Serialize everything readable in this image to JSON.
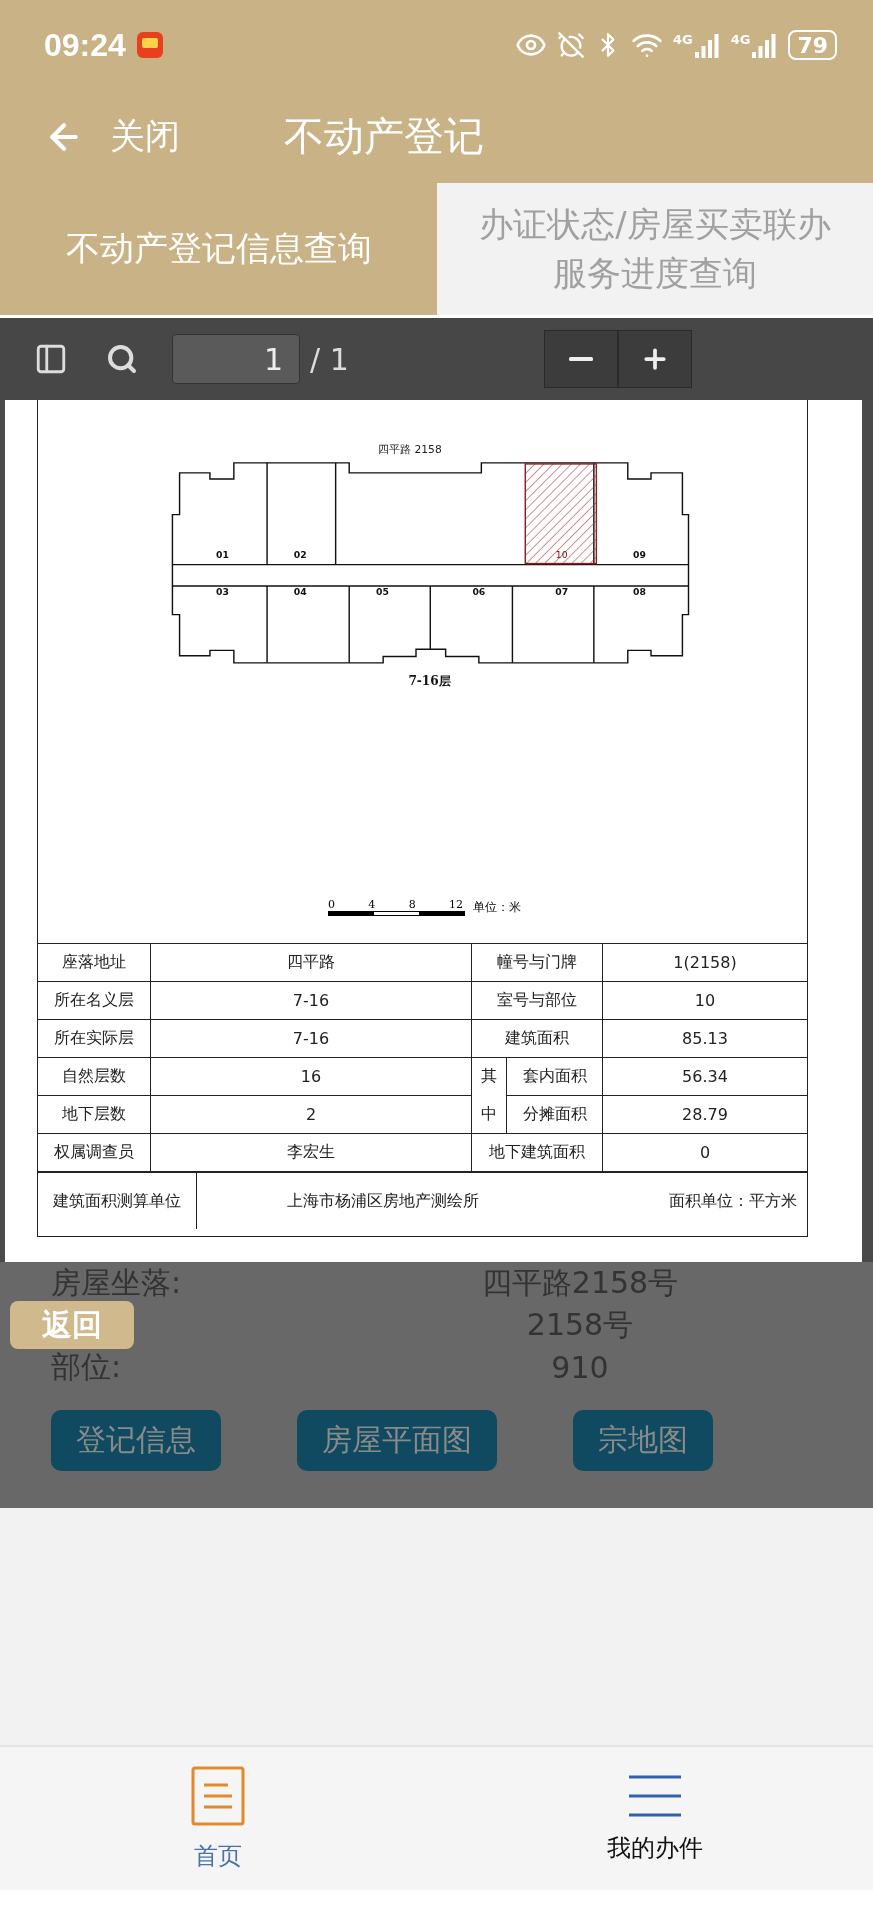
{
  "status_bar": {
    "time": "09:24",
    "networks": [
      "4G",
      "4G"
    ],
    "battery": "79"
  },
  "header": {
    "back_label": "关闭",
    "title": "不动产登记"
  },
  "tabs": [
    {
      "label": "不动产登记信息查询",
      "selected": true
    },
    {
      "label": "办证状态/房屋买卖联办服务进度查询",
      "selected": false
    }
  ],
  "pdf_viewer": {
    "page_value": "1",
    "page_total": "/ 1",
    "plan": {
      "title": "四平路 2158",
      "floor_label": "7-16层",
      "units": [
        {
          "label": "01",
          "selected": false
        },
        {
          "label": "02",
          "selected": false
        },
        {
          "label": "10",
          "selected": true
        },
        {
          "label": "09",
          "selected": false
        },
        {
          "label": "03",
          "selected": false
        },
        {
          "label": "04",
          "selected": false
        },
        {
          "label": "05",
          "selected": false
        },
        {
          "label": "06",
          "selected": false
        },
        {
          "label": "07",
          "selected": false
        },
        {
          "label": "08",
          "selected": false
        }
      ],
      "scale_ticks": [
        "0",
        "4",
        "8",
        "12"
      ],
      "scale_unit": "单位：米"
    },
    "table": {
      "rows": [
        {
          "label": "座落地址",
          "value": "四平路",
          "label_2": "幢号与门牌",
          "value_2": "1(2158)"
        },
        {
          "label": "所在名义层",
          "value": "7-16",
          "label_2": "室号与部位",
          "value_2": "10"
        },
        {
          "label": "所在实际层",
          "value": "7-16",
          "label_2": "建筑面积",
          "value_2": "85.13"
        },
        {
          "label": "自然层数",
          "value": "16",
          "group": "其",
          "label_2": "套内面积",
          "value_2": "56.34"
        },
        {
          "label": "地下层数",
          "value": "2",
          "group": "中",
          "label_2": "分摊面积",
          "value_2": "28.79"
        },
        {
          "label": "权属调查员",
          "value": "李宏生",
          "label_2": "地下建筑面积",
          "value_2": "0"
        }
      ],
      "footer": {
        "label": "建筑面积测算单位",
        "value": "上海市杨浦区房地产测绘所",
        "note": "面积单位：平方米"
      }
    }
  },
  "back_button": "返回",
  "info": {
    "rows": [
      {
        "label": "房屋坐落:",
        "value": "四平路2158号"
      },
      {
        "value": "2158号"
      },
      {
        "label": "部位:",
        "value": "910"
      }
    ],
    "buttons": [
      "登记信息",
      "房屋平面图",
      "宗地图"
    ]
  },
  "bottom_nav": [
    {
      "label": "首页",
      "kind": "home",
      "selected": true
    },
    {
      "label": "我的办件",
      "kind": "list",
      "selected": false
    }
  ]
}
